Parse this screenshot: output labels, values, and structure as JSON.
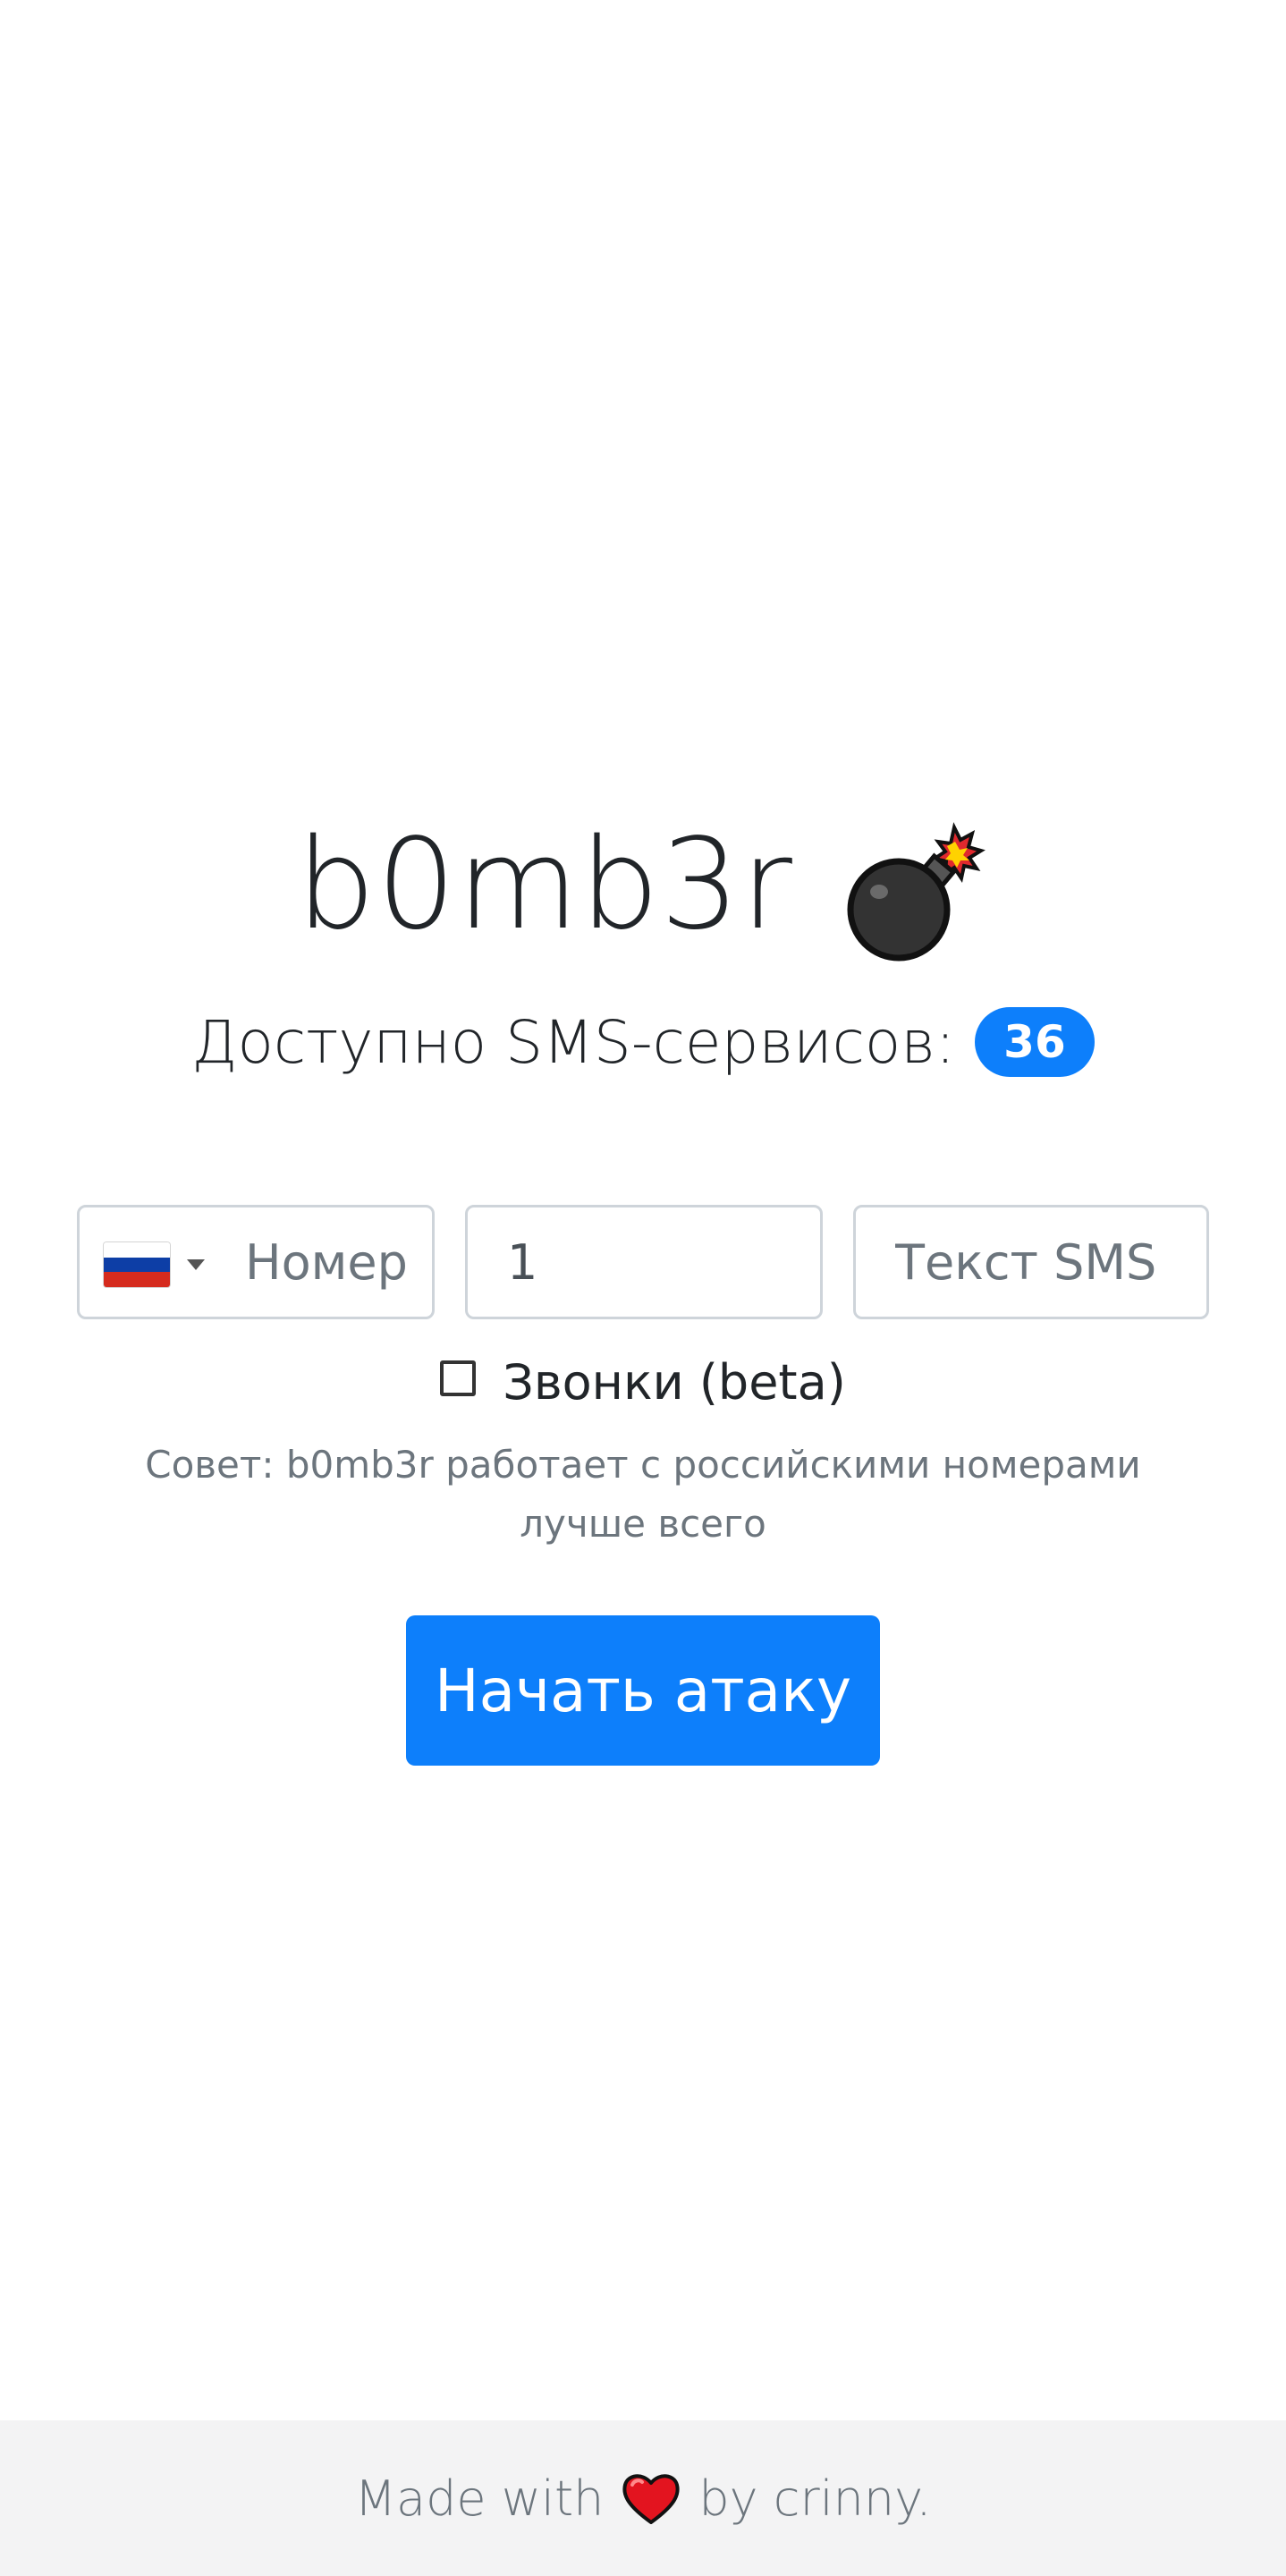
{
  "header": {
    "title": "b0mb3r",
    "subtitle_prefix": "Доступно SMS-сервисов:",
    "services_count": "36"
  },
  "form": {
    "country": {
      "flag": "russia-flag",
      "colors": [
        "#ffffff",
        "#0d3ea6",
        "#d52b1e"
      ]
    },
    "phone_placeholder": "Номер",
    "count_value": "1",
    "sms_placeholder": "Текст SMS",
    "calls_label": "Звонки (beta)",
    "calls_checked": false,
    "tip": "Совет: b0mb3r работает с российскими номерами лучше всего",
    "start_button": "Начать атаку"
  },
  "footer": {
    "made_with": "Made with",
    "by": "by crinny."
  },
  "colors": {
    "accent": "#0d7ffb",
    "footer_bg": "#f3f3f4"
  }
}
